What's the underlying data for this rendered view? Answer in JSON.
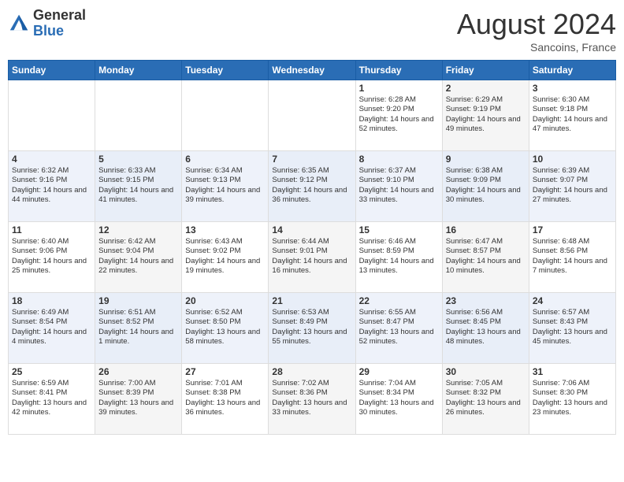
{
  "header": {
    "logo_general": "General",
    "logo_blue": "Blue",
    "month_title": "August 2024",
    "location": "Sancoins, France"
  },
  "days_of_week": [
    "Sunday",
    "Monday",
    "Tuesday",
    "Wednesday",
    "Thursday",
    "Friday",
    "Saturday"
  ],
  "weeks": [
    [
      {
        "day": "",
        "info": ""
      },
      {
        "day": "",
        "info": ""
      },
      {
        "day": "",
        "info": ""
      },
      {
        "day": "",
        "info": ""
      },
      {
        "day": "1",
        "info": "Sunrise: 6:28 AM\nSunset: 9:20 PM\nDaylight: 14 hours and 52 minutes."
      },
      {
        "day": "2",
        "info": "Sunrise: 6:29 AM\nSunset: 9:19 PM\nDaylight: 14 hours and 49 minutes."
      },
      {
        "day": "3",
        "info": "Sunrise: 6:30 AM\nSunset: 9:18 PM\nDaylight: 14 hours and 47 minutes."
      }
    ],
    [
      {
        "day": "4",
        "info": "Sunrise: 6:32 AM\nSunset: 9:16 PM\nDaylight: 14 hours and 44 minutes."
      },
      {
        "day": "5",
        "info": "Sunrise: 6:33 AM\nSunset: 9:15 PM\nDaylight: 14 hours and 41 minutes."
      },
      {
        "day": "6",
        "info": "Sunrise: 6:34 AM\nSunset: 9:13 PM\nDaylight: 14 hours and 39 minutes."
      },
      {
        "day": "7",
        "info": "Sunrise: 6:35 AM\nSunset: 9:12 PM\nDaylight: 14 hours and 36 minutes."
      },
      {
        "day": "8",
        "info": "Sunrise: 6:37 AM\nSunset: 9:10 PM\nDaylight: 14 hours and 33 minutes."
      },
      {
        "day": "9",
        "info": "Sunrise: 6:38 AM\nSunset: 9:09 PM\nDaylight: 14 hours and 30 minutes."
      },
      {
        "day": "10",
        "info": "Sunrise: 6:39 AM\nSunset: 9:07 PM\nDaylight: 14 hours and 27 minutes."
      }
    ],
    [
      {
        "day": "11",
        "info": "Sunrise: 6:40 AM\nSunset: 9:06 PM\nDaylight: 14 hours and 25 minutes."
      },
      {
        "day": "12",
        "info": "Sunrise: 6:42 AM\nSunset: 9:04 PM\nDaylight: 14 hours and 22 minutes."
      },
      {
        "day": "13",
        "info": "Sunrise: 6:43 AM\nSunset: 9:02 PM\nDaylight: 14 hours and 19 minutes."
      },
      {
        "day": "14",
        "info": "Sunrise: 6:44 AM\nSunset: 9:01 PM\nDaylight: 14 hours and 16 minutes."
      },
      {
        "day": "15",
        "info": "Sunrise: 6:46 AM\nSunset: 8:59 PM\nDaylight: 14 hours and 13 minutes."
      },
      {
        "day": "16",
        "info": "Sunrise: 6:47 AM\nSunset: 8:57 PM\nDaylight: 14 hours and 10 minutes."
      },
      {
        "day": "17",
        "info": "Sunrise: 6:48 AM\nSunset: 8:56 PM\nDaylight: 14 hours and 7 minutes."
      }
    ],
    [
      {
        "day": "18",
        "info": "Sunrise: 6:49 AM\nSunset: 8:54 PM\nDaylight: 14 hours and 4 minutes."
      },
      {
        "day": "19",
        "info": "Sunrise: 6:51 AM\nSunset: 8:52 PM\nDaylight: 14 hours and 1 minute."
      },
      {
        "day": "20",
        "info": "Sunrise: 6:52 AM\nSunset: 8:50 PM\nDaylight: 13 hours and 58 minutes."
      },
      {
        "day": "21",
        "info": "Sunrise: 6:53 AM\nSunset: 8:49 PM\nDaylight: 13 hours and 55 minutes."
      },
      {
        "day": "22",
        "info": "Sunrise: 6:55 AM\nSunset: 8:47 PM\nDaylight: 13 hours and 52 minutes."
      },
      {
        "day": "23",
        "info": "Sunrise: 6:56 AM\nSunset: 8:45 PM\nDaylight: 13 hours and 48 minutes."
      },
      {
        "day": "24",
        "info": "Sunrise: 6:57 AM\nSunset: 8:43 PM\nDaylight: 13 hours and 45 minutes."
      }
    ],
    [
      {
        "day": "25",
        "info": "Sunrise: 6:59 AM\nSunset: 8:41 PM\nDaylight: 13 hours and 42 minutes."
      },
      {
        "day": "26",
        "info": "Sunrise: 7:00 AM\nSunset: 8:39 PM\nDaylight: 13 hours and 39 minutes."
      },
      {
        "day": "27",
        "info": "Sunrise: 7:01 AM\nSunset: 8:38 PM\nDaylight: 13 hours and 36 minutes."
      },
      {
        "day": "28",
        "info": "Sunrise: 7:02 AM\nSunset: 8:36 PM\nDaylight: 13 hours and 33 minutes."
      },
      {
        "day": "29",
        "info": "Sunrise: 7:04 AM\nSunset: 8:34 PM\nDaylight: 13 hours and 30 minutes."
      },
      {
        "day": "30",
        "info": "Sunrise: 7:05 AM\nSunset: 8:32 PM\nDaylight: 13 hours and 26 minutes."
      },
      {
        "day": "31",
        "info": "Sunrise: 7:06 AM\nSunset: 8:30 PM\nDaylight: 13 hours and 23 minutes."
      }
    ]
  ]
}
